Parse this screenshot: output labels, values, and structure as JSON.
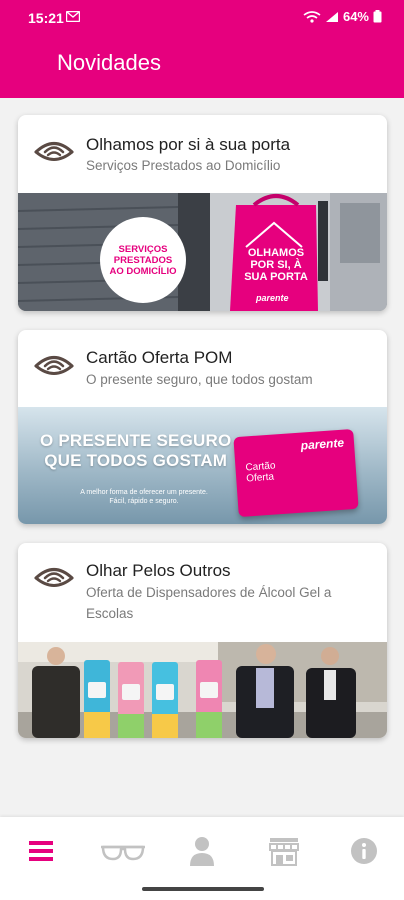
{
  "status": {
    "time": "15:21",
    "battery": "64%"
  },
  "header": {
    "title": "Novidades"
  },
  "cards": [
    {
      "title": "Olhamos por si à sua porta",
      "subtitle": "Serviços Prestados ao Domicílio",
      "banner": {
        "badge": [
          "SERVIÇOS",
          "PRESTADOS",
          "AO DOMICÍLIO"
        ],
        "bag": [
          "OLHAMOS",
          "POR SI, À",
          "SUA PORTA"
        ],
        "brand": "parente"
      }
    },
    {
      "title": "Cartão Oferta POM",
      "subtitle": "O presente seguro, que todos gostam",
      "banner": {
        "headline": [
          "O PRESENTE SEGURO",
          "QUE TODOS GOSTAM"
        ],
        "tagline": [
          "A melhor forma de oferecer um presente.",
          "Fácil, rápido e seguro."
        ],
        "card_brand": "parente",
        "card_label": [
          "Cartão",
          "Oferta"
        ]
      }
    },
    {
      "title": "Olhar Pelos Outros",
      "subtitle": "Oferta de Dispensadores de Álcool Gel a Escolas"
    }
  ],
  "bottom_nav": [
    {
      "name": "menu-icon",
      "active": true
    },
    {
      "name": "glasses-icon",
      "active": false
    },
    {
      "name": "user-icon",
      "active": false
    },
    {
      "name": "store-icon",
      "active": false
    },
    {
      "name": "info-icon",
      "active": false
    }
  ],
  "colors": {
    "brand": "#e6007e",
    "nav_inactive": "#c2c2c2",
    "icon_brown": "#5a4a44"
  }
}
